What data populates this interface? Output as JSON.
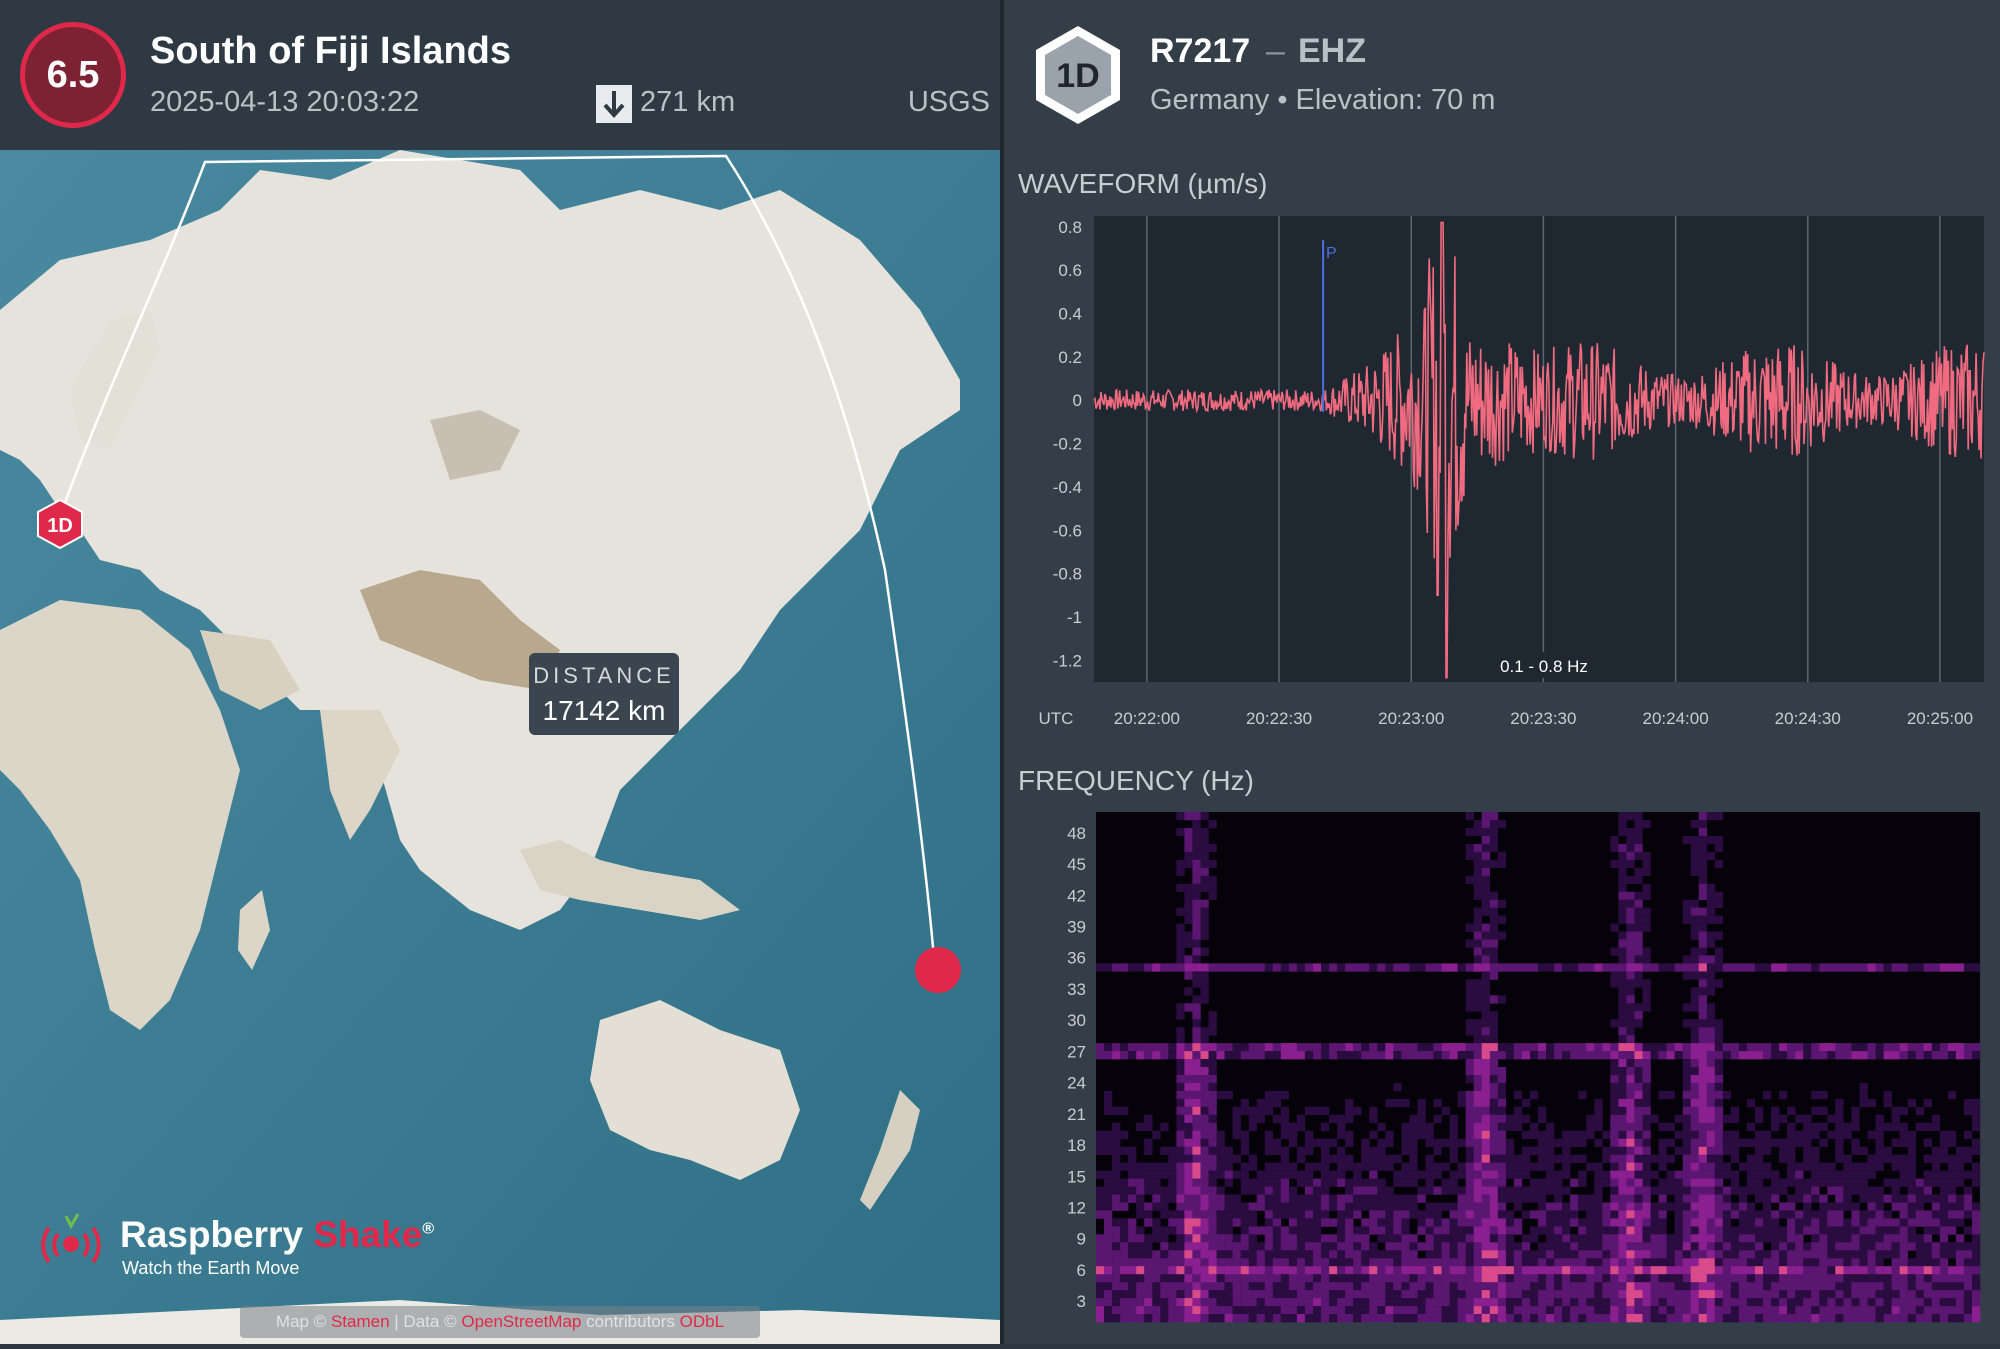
{
  "event": {
    "magnitude": "6.5",
    "title": "South of Fiji Islands",
    "datetime": "2025-04-13 20:03:22",
    "depth_icon": "down-arrow-icon",
    "depth": "271 km",
    "source": "USGS"
  },
  "map": {
    "station_marker": "1D",
    "distance_label": "DISTANCE",
    "distance_value": "17142 km",
    "brand_name_part1": "Raspberry",
    "brand_name_part2": "Shake",
    "brand_reg": "®",
    "brand_tagline": "Watch the Earth Move",
    "attribution": {
      "prefix": "Map ©",
      "link1": "Stamen",
      "mid": "| Data ©",
      "link2": "OpenStreetMap",
      "suffix": "contributors",
      "link3": "ODbL"
    },
    "colors": {
      "marker": "#e0294a",
      "path": "#ffffff"
    }
  },
  "station": {
    "badge": "1D",
    "code": "R7217",
    "separator": "–",
    "channel": "EHZ",
    "location": "Germany • Elevation: 70 m"
  },
  "waveform": {
    "title": "WAVEFORM (µm/s)",
    "filter": "0.1 - 0.8 Hz",
    "utc_label": "UTC",
    "pick_label": "P",
    "line_color": "#f06a80",
    "pick_color": "#4a6fe0"
  },
  "frequency": {
    "title": "FREQUENCY (Hz)"
  },
  "chart_data": [
    {
      "type": "line",
      "title": "WAVEFORM (µm/s)",
      "ylabel": "µm/s",
      "xlabel": "UTC",
      "ylim": [
        -1.3,
        0.85
      ],
      "yticks": [
        "0.8",
        "0.6",
        "0.4",
        "0.2",
        "0",
        "-0.2",
        "-0.4",
        "-0.6",
        "-0.8",
        "-1",
        "-1.2"
      ],
      "xticks": [
        "20:22:00",
        "20:22:30",
        "20:23:00",
        "20:23:30",
        "20:24:00",
        "20:24:30",
        "20:25:00"
      ],
      "xlim_seconds": [
        -12,
        190
      ],
      "annotations": [
        {
          "label": "P",
          "x": "20:22:40"
        },
        {
          "label": "0.1 - 0.8 Hz"
        }
      ],
      "grid": true,
      "series": [
        {
          "color": "#f06a80",
          "envelope": [
            {
              "t": "20:21:48",
              "amp": 0.08
            },
            {
              "t": "20:22:40",
              "amp": 0.1
            },
            {
              "t": "20:22:50",
              "amp": 0.25
            },
            {
              "t": "20:23:08",
              "amp": 0.85
            },
            {
              "t": "20:23:08",
              "min": -1.28
            },
            {
              "t": "20:23:20",
              "amp": 0.4
            },
            {
              "t": "20:24:10",
              "amp": 0.35
            },
            {
              "t": "20:25:10",
              "amp": 0.25
            }
          ]
        }
      ]
    },
    {
      "type": "heatmap",
      "title": "FREQUENCY (Hz)",
      "ylabel": "Hz",
      "yticks": [
        "48",
        "45",
        "42",
        "39",
        "36",
        "33",
        "30",
        "27",
        "24",
        "21",
        "18",
        "15",
        "12",
        "9",
        "6",
        "3"
      ],
      "ylim": [
        1,
        50
      ],
      "colors": [
        "#05020a",
        "#3c0f5a",
        "#8a1f8f",
        "#d84a8a"
      ]
    }
  ]
}
